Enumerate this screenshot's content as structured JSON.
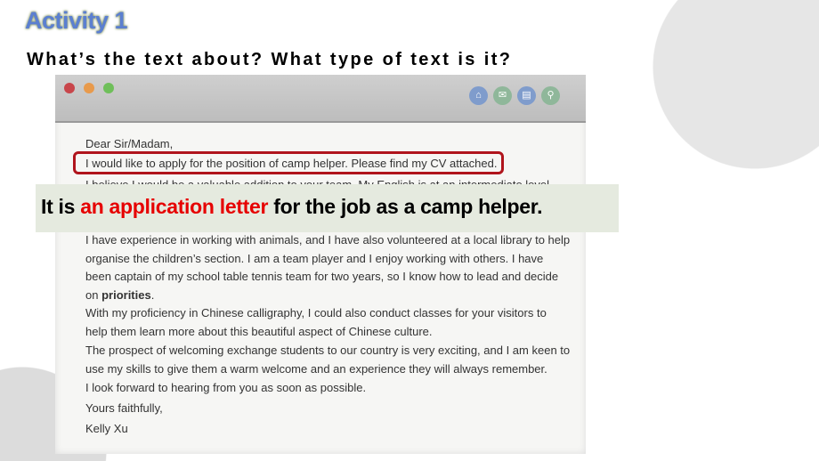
{
  "slide": {
    "title": "Activity 1",
    "question": "What’s the text about? What type of text is it?",
    "answer": {
      "prefix": "It is ",
      "highlight": "an application letter",
      "suffix": " for the job as a camp helper."
    },
    "colors": {
      "title": "#5b7fd0",
      "highlight_text": "#e60000",
      "box_border": "#b0141c",
      "banner_bg": "#e5eadf"
    }
  },
  "window": {
    "controls": [
      "close",
      "minimize",
      "maximize"
    ],
    "toolbar_icons": [
      "home-icon",
      "mail-icon",
      "document-icon",
      "search-icon"
    ]
  },
  "letter": {
    "greeting": "Dear Sir/Madam,",
    "highlighted_line": "I would like to apply for the position of camp helper. Please find my CV attached.",
    "obscured_line": "I believe I would be a valuable addition to your team. My English is at an intermediate level",
    "p1": "I have experience in working with animals, and I have also volunteered at a local library to help organise the children’s section. I am a team player and I enjoy working with others. I have been captain of my school table tennis team for two years, so I know how to lead and decide on ",
    "p1_bold": "priorities",
    "p1_end": ".",
    "p2": "With my proficiency in Chinese calligraphy, I could also conduct classes for your visitors to help them learn more about this beautiful aspect of Chinese culture.",
    "p3": "The prospect of welcoming exchange students to our country is very exciting, and I am keen to use my skills to give them a warm welcome and an experience they will always remember.",
    "p4": "I look forward to hearing from you as soon as possible.",
    "closing": "Yours faithfully,",
    "signature": "Kelly Xu"
  }
}
